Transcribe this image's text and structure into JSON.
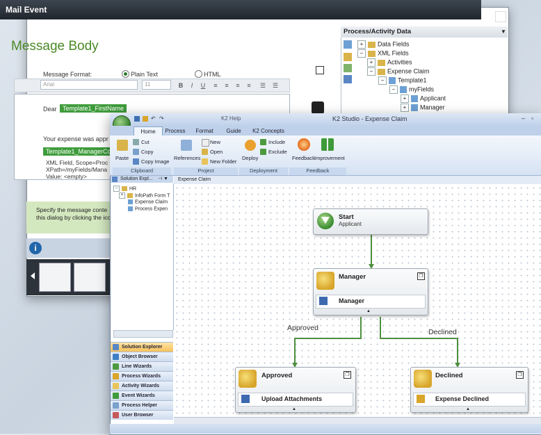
{
  "mail_event": {
    "title": "Mail Event",
    "heading": "Message Body",
    "format_label": "Message Format:",
    "format_options": [
      "Plain Text",
      "HTML"
    ],
    "format_selected": "Plain Text",
    "font_name": "Arial",
    "font_size": "11",
    "body_greeting": "Dear",
    "field_first_name": "Template1_FirstName",
    "body_line2": "Your expense was appr",
    "field_manager": "Template1_ManagerCo",
    "xml_info": [
      "XML Field, Scope=Proc",
      "XPath=/myFields/Mana",
      "Value: <empty>"
    ],
    "hint": [
      "Specify the message conte",
      "this dialog by clicking the ico"
    ]
  },
  "process_data": {
    "title": "Process/Activity Data",
    "tree": [
      {
        "label": "Data Fields",
        "level": 0,
        "expander": "+"
      },
      {
        "label": "XML Fields",
        "level": 0,
        "expander": "-"
      },
      {
        "label": "Activities",
        "level": 1,
        "expander": "+"
      },
      {
        "label": "Expense Claim",
        "level": 1,
        "expander": "-"
      },
      {
        "label": "Template1",
        "level": 2,
        "expander": "-"
      },
      {
        "label": "myFields",
        "level": 3,
        "expander": "-"
      },
      {
        "label": "Applicant",
        "level": 4,
        "expander": "+"
      },
      {
        "label": "Manager",
        "level": 4,
        "expander": "+"
      }
    ]
  },
  "k2_studio": {
    "title": "K2 Studio - Expense Claim",
    "help_tab": "K2 Help",
    "tabs": [
      "Home",
      "Process",
      "Format",
      "Guide",
      "K2 Concepts"
    ],
    "active_tab": "Home",
    "ribbon": {
      "clipboard": {
        "label": "Clipboard",
        "paste": "Paste",
        "cut": "Cut",
        "copy": "Copy",
        "copy_image": "Copy Image"
      },
      "project": {
        "label": "Project",
        "references": "References",
        "new": "New",
        "open": "Open",
        "new_folder": "New Folder"
      },
      "deployment": {
        "label": "Deployment",
        "deploy": "Deploy",
        "include": "Include",
        "exclude": "Exclude"
      },
      "feedback": {
        "label": "Feedback",
        "feedback": "Feedback",
        "improvement": "Improvement"
      }
    },
    "solution_explorer": {
      "header": "Solution Expl...",
      "items": [
        "HR",
        "InfoPath Form T",
        "Expense Claim",
        "Process Expen"
      ]
    },
    "sidebar_buttons": [
      "Solution Explorer",
      "Object Browser",
      "Line Wizards",
      "Process Wizards",
      "Activity Wizards",
      "Event Wizards",
      "Process Helper",
      "User Browser"
    ],
    "sidebar_active": "Solution Explorer",
    "canvas_tab": "Expense Claim",
    "nodes": {
      "start": {
        "title": "Start",
        "sub": "Applicant"
      },
      "manager": {
        "title": "Manager",
        "event": "Manager"
      },
      "approved": {
        "title": "Approved",
        "event": "Upload Attachments"
      },
      "declined": {
        "title": "Declined",
        "event": "Expense Declined"
      }
    },
    "edges": {
      "approved": "Approved",
      "declined": "Declined"
    }
  },
  "colors": {
    "accent_green": "#4d8f3f",
    "ribbon_blue": "#bfd1ea",
    "active_orange": "#f7c15a"
  }
}
